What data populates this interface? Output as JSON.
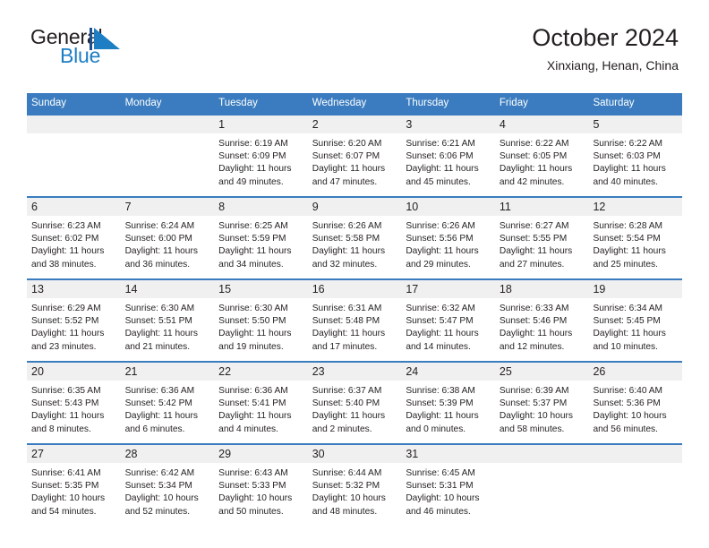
{
  "brand": {
    "name_part1": "General",
    "name_part2": "Blue",
    "mark_icon": "triangle-logo-icon",
    "accent_color": "#1d7ec4"
  },
  "header": {
    "title": "October 2024",
    "subtitle": "Xinxiang, Henan, China"
  },
  "theme": {
    "header_blue": "#3a7cbf",
    "number_band": "#f0f0f0",
    "text": "#231f20"
  },
  "weekday_headers": [
    "Sunday",
    "Monday",
    "Tuesday",
    "Wednesday",
    "Thursday",
    "Friday",
    "Saturday"
  ],
  "weeks": [
    {
      "days": [
        {
          "num": "",
          "sunrise": "",
          "sunset": "",
          "daylight1": "",
          "daylight2": ""
        },
        {
          "num": "",
          "sunrise": "",
          "sunset": "",
          "daylight1": "",
          "daylight2": ""
        },
        {
          "num": "1",
          "sunrise": "Sunrise: 6:19 AM",
          "sunset": "Sunset: 6:09 PM",
          "daylight1": "Daylight: 11 hours",
          "daylight2": "and 49 minutes."
        },
        {
          "num": "2",
          "sunrise": "Sunrise: 6:20 AM",
          "sunset": "Sunset: 6:07 PM",
          "daylight1": "Daylight: 11 hours",
          "daylight2": "and 47 minutes."
        },
        {
          "num": "3",
          "sunrise": "Sunrise: 6:21 AM",
          "sunset": "Sunset: 6:06 PM",
          "daylight1": "Daylight: 11 hours",
          "daylight2": "and 45 minutes."
        },
        {
          "num": "4",
          "sunrise": "Sunrise: 6:22 AM",
          "sunset": "Sunset: 6:05 PM",
          "daylight1": "Daylight: 11 hours",
          "daylight2": "and 42 minutes."
        },
        {
          "num": "5",
          "sunrise": "Sunrise: 6:22 AM",
          "sunset": "Sunset: 6:03 PM",
          "daylight1": "Daylight: 11 hours",
          "daylight2": "and 40 minutes."
        }
      ]
    },
    {
      "days": [
        {
          "num": "6",
          "sunrise": "Sunrise: 6:23 AM",
          "sunset": "Sunset: 6:02 PM",
          "daylight1": "Daylight: 11 hours",
          "daylight2": "and 38 minutes."
        },
        {
          "num": "7",
          "sunrise": "Sunrise: 6:24 AM",
          "sunset": "Sunset: 6:00 PM",
          "daylight1": "Daylight: 11 hours",
          "daylight2": "and 36 minutes."
        },
        {
          "num": "8",
          "sunrise": "Sunrise: 6:25 AM",
          "sunset": "Sunset: 5:59 PM",
          "daylight1": "Daylight: 11 hours",
          "daylight2": "and 34 minutes."
        },
        {
          "num": "9",
          "sunrise": "Sunrise: 6:26 AM",
          "sunset": "Sunset: 5:58 PM",
          "daylight1": "Daylight: 11 hours",
          "daylight2": "and 32 minutes."
        },
        {
          "num": "10",
          "sunrise": "Sunrise: 6:26 AM",
          "sunset": "Sunset: 5:56 PM",
          "daylight1": "Daylight: 11 hours",
          "daylight2": "and 29 minutes."
        },
        {
          "num": "11",
          "sunrise": "Sunrise: 6:27 AM",
          "sunset": "Sunset: 5:55 PM",
          "daylight1": "Daylight: 11 hours",
          "daylight2": "and 27 minutes."
        },
        {
          "num": "12",
          "sunrise": "Sunrise: 6:28 AM",
          "sunset": "Sunset: 5:54 PM",
          "daylight1": "Daylight: 11 hours",
          "daylight2": "and 25 minutes."
        }
      ]
    },
    {
      "days": [
        {
          "num": "13",
          "sunrise": "Sunrise: 6:29 AM",
          "sunset": "Sunset: 5:52 PM",
          "daylight1": "Daylight: 11 hours",
          "daylight2": "and 23 minutes."
        },
        {
          "num": "14",
          "sunrise": "Sunrise: 6:30 AM",
          "sunset": "Sunset: 5:51 PM",
          "daylight1": "Daylight: 11 hours",
          "daylight2": "and 21 minutes."
        },
        {
          "num": "15",
          "sunrise": "Sunrise: 6:30 AM",
          "sunset": "Sunset: 5:50 PM",
          "daylight1": "Daylight: 11 hours",
          "daylight2": "and 19 minutes."
        },
        {
          "num": "16",
          "sunrise": "Sunrise: 6:31 AM",
          "sunset": "Sunset: 5:48 PM",
          "daylight1": "Daylight: 11 hours",
          "daylight2": "and 17 minutes."
        },
        {
          "num": "17",
          "sunrise": "Sunrise: 6:32 AM",
          "sunset": "Sunset: 5:47 PM",
          "daylight1": "Daylight: 11 hours",
          "daylight2": "and 14 minutes."
        },
        {
          "num": "18",
          "sunrise": "Sunrise: 6:33 AM",
          "sunset": "Sunset: 5:46 PM",
          "daylight1": "Daylight: 11 hours",
          "daylight2": "and 12 minutes."
        },
        {
          "num": "19",
          "sunrise": "Sunrise: 6:34 AM",
          "sunset": "Sunset: 5:45 PM",
          "daylight1": "Daylight: 11 hours",
          "daylight2": "and 10 minutes."
        }
      ]
    },
    {
      "days": [
        {
          "num": "20",
          "sunrise": "Sunrise: 6:35 AM",
          "sunset": "Sunset: 5:43 PM",
          "daylight1": "Daylight: 11 hours",
          "daylight2": "and 8 minutes."
        },
        {
          "num": "21",
          "sunrise": "Sunrise: 6:36 AM",
          "sunset": "Sunset: 5:42 PM",
          "daylight1": "Daylight: 11 hours",
          "daylight2": "and 6 minutes."
        },
        {
          "num": "22",
          "sunrise": "Sunrise: 6:36 AM",
          "sunset": "Sunset: 5:41 PM",
          "daylight1": "Daylight: 11 hours",
          "daylight2": "and 4 minutes."
        },
        {
          "num": "23",
          "sunrise": "Sunrise: 6:37 AM",
          "sunset": "Sunset: 5:40 PM",
          "daylight1": "Daylight: 11 hours",
          "daylight2": "and 2 minutes."
        },
        {
          "num": "24",
          "sunrise": "Sunrise: 6:38 AM",
          "sunset": "Sunset: 5:39 PM",
          "daylight1": "Daylight: 11 hours",
          "daylight2": "and 0 minutes."
        },
        {
          "num": "25",
          "sunrise": "Sunrise: 6:39 AM",
          "sunset": "Sunset: 5:37 PM",
          "daylight1": "Daylight: 10 hours",
          "daylight2": "and 58 minutes."
        },
        {
          "num": "26",
          "sunrise": "Sunrise: 6:40 AM",
          "sunset": "Sunset: 5:36 PM",
          "daylight1": "Daylight: 10 hours",
          "daylight2": "and 56 minutes."
        }
      ]
    },
    {
      "days": [
        {
          "num": "27",
          "sunrise": "Sunrise: 6:41 AM",
          "sunset": "Sunset: 5:35 PM",
          "daylight1": "Daylight: 10 hours",
          "daylight2": "and 54 minutes."
        },
        {
          "num": "28",
          "sunrise": "Sunrise: 6:42 AM",
          "sunset": "Sunset: 5:34 PM",
          "daylight1": "Daylight: 10 hours",
          "daylight2": "and 52 minutes."
        },
        {
          "num": "29",
          "sunrise": "Sunrise: 6:43 AM",
          "sunset": "Sunset: 5:33 PM",
          "daylight1": "Daylight: 10 hours",
          "daylight2": "and 50 minutes."
        },
        {
          "num": "30",
          "sunrise": "Sunrise: 6:44 AM",
          "sunset": "Sunset: 5:32 PM",
          "daylight1": "Daylight: 10 hours",
          "daylight2": "and 48 minutes."
        },
        {
          "num": "31",
          "sunrise": "Sunrise: 6:45 AM",
          "sunset": "Sunset: 5:31 PM",
          "daylight1": "Daylight: 10 hours",
          "daylight2": "and 46 minutes."
        },
        {
          "num": "",
          "sunrise": "",
          "sunset": "",
          "daylight1": "",
          "daylight2": ""
        },
        {
          "num": "",
          "sunrise": "",
          "sunset": "",
          "daylight1": "",
          "daylight2": ""
        }
      ]
    }
  ]
}
